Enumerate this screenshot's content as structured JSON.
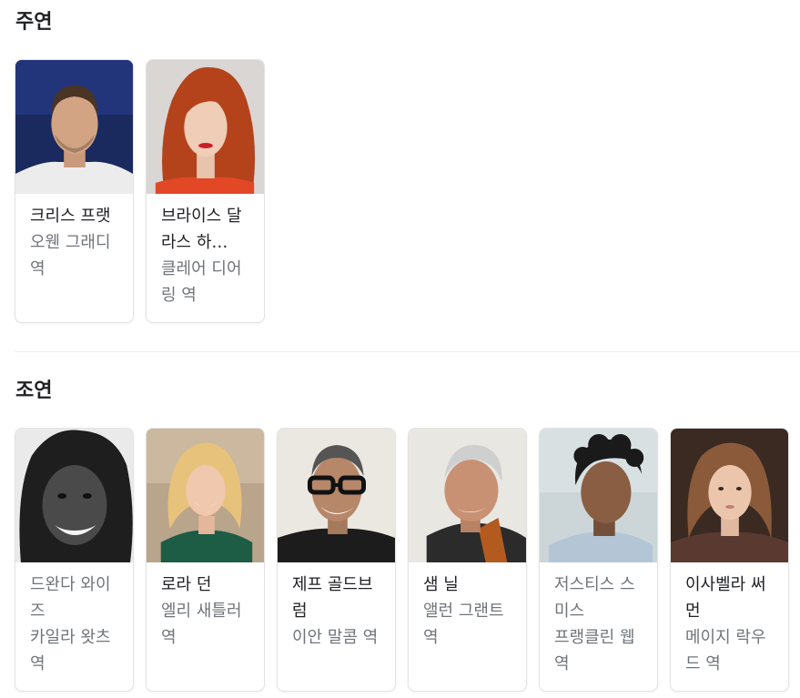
{
  "main_cast": {
    "title": "주연",
    "cards": [
      {
        "actor": "크리스 프랫",
        "role": "오웬 그래디 역"
      },
      {
        "actor": "브라이스 달라스 하…",
        "role": "클레어 디어링 역"
      }
    ]
  },
  "supporting_cast": {
    "title": "조연",
    "cards": [
      {
        "actor": "드완다 와이즈",
        "role": "카일라 왓츠 역"
      },
      {
        "actor": "로라 던",
        "role": "엘리 새틀러 역"
      },
      {
        "actor": "제프 골드브럼",
        "role": "이안 말콤 역"
      },
      {
        "actor": "샘 닐",
        "role": "앨런 그랜트 역"
      },
      {
        "actor": "저스티스 스미스",
        "role": "프랭클린 웹 역"
      },
      {
        "actor": "이사벨라 써먼",
        "role": "메이지 락우드 역"
      }
    ]
  }
}
